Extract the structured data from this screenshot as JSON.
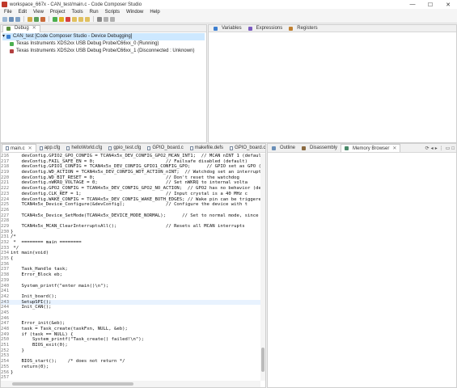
{
  "window": {
    "title": "workspace_667x - CAN_test/main.c - Code Composer Studio",
    "minimize": "—",
    "maximize": "☐",
    "close": "✕"
  },
  "menu": [
    "File",
    "Edit",
    "View",
    "Project",
    "Tools",
    "Run",
    "Scripts",
    "Window",
    "Help"
  ],
  "debug_panel": {
    "tab": "Debug",
    "tree": [
      "CAN_test [Code Composer Studio - Device Debugging]",
      "Texas Instruments XDS2xx USB Debug Probe/C66xx_0 (Running)",
      "Texas Instruments XDS2xx USB Debug Probe/C66xx_1 (Disconnected : Unknown)"
    ]
  },
  "vars_panel": {
    "tabs": [
      "Variables",
      "Expressions",
      "Registers"
    ]
  },
  "editor": {
    "tabs": [
      "main.c",
      "app.cfg",
      "helloWorld.cfg",
      "gpio_test.cfg",
      "GPIO_board.c",
      "makefile.defs",
      "GPIO_board.c"
    ],
    "lines": [
      {
        "n": "216",
        "t": "    devConfig.GPIO2_GPO_CONFIG = TCAN4x5x_DEV_CONFIG_GPO2_MCAN_INT1;  // MCAN nINT 1 (default)"
      },
      {
        "n": "217",
        "t": "    devConfig.FAIL_SAFE_EN = 0;                          // Failsafe disabled (default)"
      },
      {
        "n": "218",
        "t": "    devConfig.GPIO1_CONFIG = TCAN4x5x_DEV_CONFIG_GPIO1_CONFIG_GPO;      // GPIO set as GPO (De"
      },
      {
        "n": "219",
        "t": "    devConfig.WD_ACTION = TCAN4x5x_DEV_CONFIG_WDT_ACTION_nINT;  // Watchdog set an interrupt ("
      },
      {
        "n": "220",
        "t": "    devConfig.WD_BIT_RESET = 0;                          // Don't reset the watchdog"
      },
      {
        "n": "221",
        "t": "    devConfig.nWKRQ_VOLTAGE = 0;                         // Set nWKRQ to internal volta"
      },
      {
        "n": "222",
        "t": "    devConfig.GPO2_CONFIG = TCAN4x5x_DEV_CONFIG_GPO2_NO_ACTION;  // GPO2 has no behavior (defau"
      },
      {
        "n": "223",
        "t": "    devConfig.CLK_REF = 1;                               // Input crystal is a 40 MHz c"
      },
      {
        "n": "224",
        "t": "    devConfig.WAKE_CONFIG = TCAN4x5x_DEV_CONFIG_WAKE_BOTH_EDGES; // Wake pin can be triggered b"
      },
      {
        "n": "225",
        "t": "    TCAN4x5x_Device_Configure(&devConfig);               // Configure the device with t"
      },
      {
        "n": "226",
        "t": ""
      },
      {
        "n": "227",
        "t": "    TCAN4x5x_Device_SetMode(TCAN4x5x_DEVICE_MODE_NORMAL);      // Set to normal mode, since c"
      },
      {
        "n": "228",
        "t": ""
      },
      {
        "n": "229",
        "t": "    TCAN4x5x_MCAN_ClearInterruptsAll();                  // Resets all MCAN interrupts"
      },
      {
        "n": "230",
        "t": "}"
      },
      {
        "n": "231",
        "t": "/*"
      },
      {
        "n": "232",
        "t": " *  ======== main ========"
      },
      {
        "n": "233",
        "t": " */"
      },
      {
        "n": "234",
        "t": "int main(void)"
      },
      {
        "n": "235",
        "t": "{"
      },
      {
        "n": "236",
        "t": ""
      },
      {
        "n": "237",
        "t": "    Task_Handle task;"
      },
      {
        "n": "238",
        "t": "    Error_Block eb;"
      },
      {
        "n": "239",
        "t": ""
      },
      {
        "n": "240",
        "t": "    System_printf(\"enter main()\\n\");"
      },
      {
        "n": "241",
        "t": ""
      },
      {
        "n": "242",
        "t": "    Init_board();"
      },
      {
        "n": "243",
        "t": "    SetupSPI();"
      },
      {
        "n": "244",
        "t": "    Init_CAN();"
      },
      {
        "n": "245",
        "t": ""
      },
      {
        "n": "246",
        "t": ""
      },
      {
        "n": "247",
        "t": "    Error_init(&eb);"
      },
      {
        "n": "248",
        "t": "    task = Task_create(taskFxn, NULL, &eb);"
      },
      {
        "n": "249",
        "t": "    if (task == NULL) {"
      },
      {
        "n": "250",
        "t": "        System_printf(\"Task_create() failed!\\n\");"
      },
      {
        "n": "251",
        "t": "        BIOS_exit(0);"
      },
      {
        "n": "252",
        "t": "    }"
      },
      {
        "n": "253",
        "t": ""
      },
      {
        "n": "254",
        "t": "    BIOS_start();    /* does not return */"
      },
      {
        "n": "255",
        "t": "    return(0);"
      },
      {
        "n": "256",
        "t": "}"
      },
      {
        "n": "257",
        "t": ""
      }
    ]
  },
  "right_panel": {
    "tabs": [
      "Outline",
      "Disassembly",
      "Memory Browser"
    ]
  },
  "colors": {
    "accent": "#0a64c8",
    "highlight_line": "#e8f2fe",
    "selection": "#cde8ff"
  }
}
